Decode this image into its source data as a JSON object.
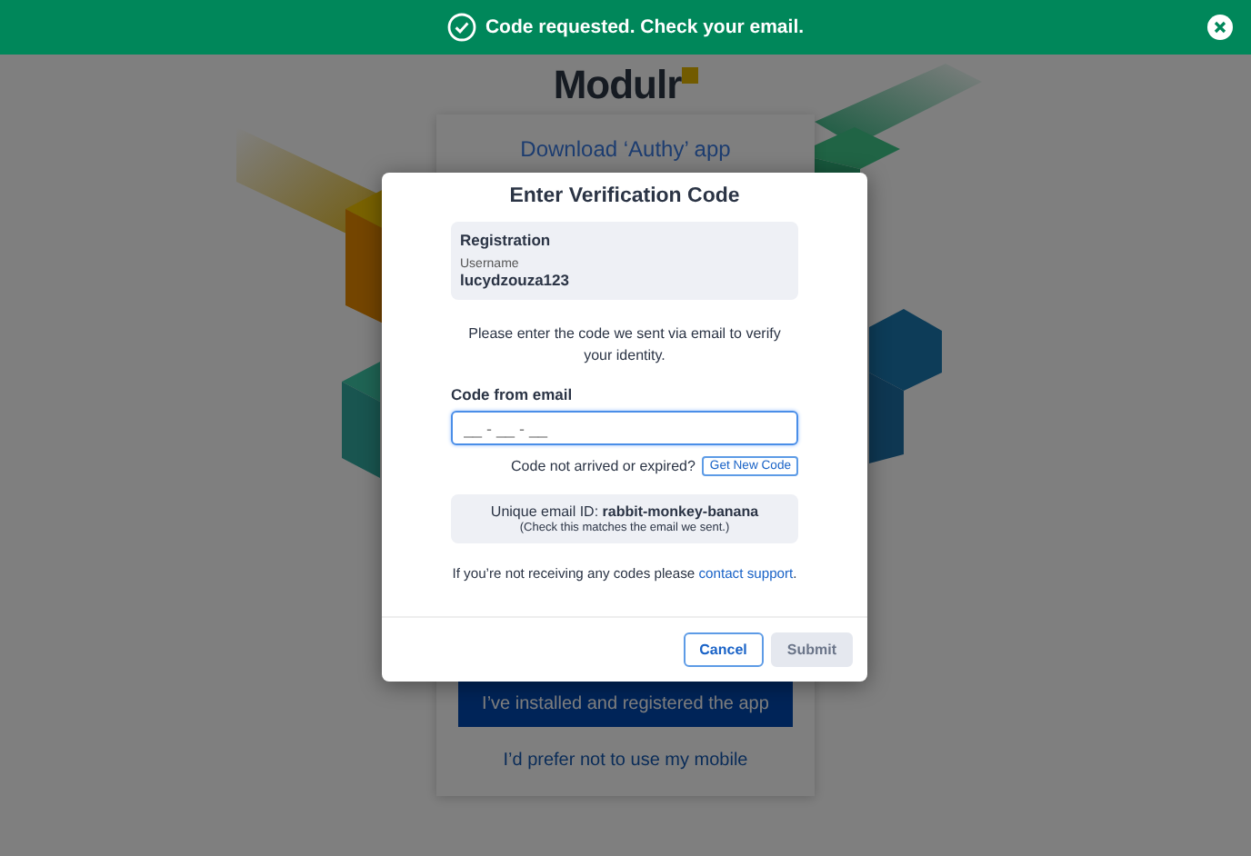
{
  "notification": {
    "message": "Code requested. Check your email.",
    "kind": "success"
  },
  "background_page": {
    "logo": "Modulr",
    "card_title": "Download ‘Authy’ app",
    "primary_button": "I’ve installed and registered the app",
    "secondary_link": "I’d prefer not to use my mobile"
  },
  "dialog": {
    "title": "Enter Verification Code",
    "registration": {
      "heading": "Registration",
      "username_label": "Username",
      "username": "lucydzouza123"
    },
    "instructions": "Please enter the code we sent via email to verify your identity.",
    "code_field": {
      "label": "Code from email",
      "placeholder": "__ - __ - __",
      "focused": true
    },
    "resend": {
      "prompt": "Code not arrived or expired?",
      "button": "Get New Code"
    },
    "email_id": {
      "text": "Unique email ID: **rabbit-monkey-banana**",
      "note": "(Check this matches the email we sent.)"
    },
    "support": {
      "text": "If you’re not receiving any codes please",
      "link": "contact support",
      "after": "."
    },
    "buttons": [
      {
        "label": "Cancel",
        "kind": "secondary",
        "disabled": false
      },
      {
        "label": "Submit",
        "kind": "primary",
        "disabled": true
      }
    ]
  }
}
